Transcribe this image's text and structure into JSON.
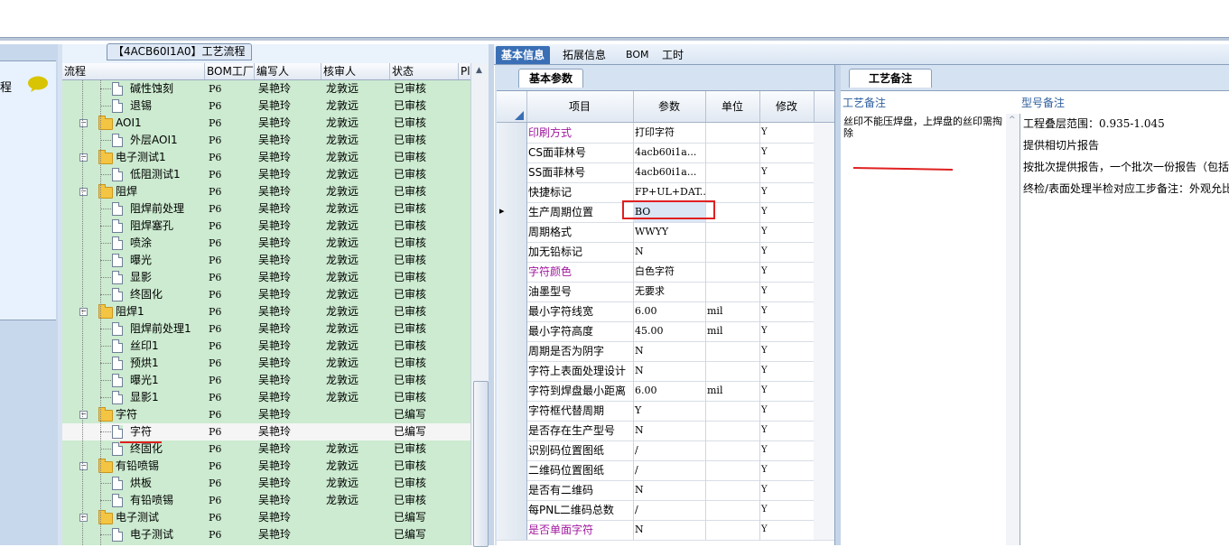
{
  "left_panel": {
    "label": "程"
  },
  "process_panel": {
    "title": "【4ACB60I1A0】工艺流程",
    "columns": [
      "流程",
      "BOM工厂",
      "编写人",
      "核审人",
      "状态",
      "Pl"
    ],
    "rows": [
      {
        "name": "碱性蚀刻",
        "type": "doc",
        "level": 2,
        "factory": "P6",
        "writer": "吴艳玲",
        "reviewer": "龙敦远",
        "status": "已审核"
      },
      {
        "name": "退锡",
        "type": "doc",
        "level": 2,
        "factory": "P6",
        "writer": "吴艳玲",
        "reviewer": "龙敦远",
        "status": "已审核"
      },
      {
        "name": "AOI1",
        "type": "folder",
        "level": 1,
        "factory": "P6",
        "writer": "吴艳玲",
        "reviewer": "龙敦远",
        "status": "已审核"
      },
      {
        "name": "外层AOI1",
        "type": "doc",
        "level": 2,
        "factory": "P6",
        "writer": "吴艳玲",
        "reviewer": "龙敦远",
        "status": "已审核"
      },
      {
        "name": "电子测试1",
        "type": "folder",
        "level": 1,
        "factory": "P6",
        "writer": "吴艳玲",
        "reviewer": "龙敦远",
        "status": "已审核"
      },
      {
        "name": "低阻测试1",
        "type": "doc",
        "level": 2,
        "factory": "P6",
        "writer": "吴艳玲",
        "reviewer": "龙敦远",
        "status": "已审核"
      },
      {
        "name": "阻焊",
        "type": "folder",
        "level": 1,
        "factory": "P6",
        "writer": "吴艳玲",
        "reviewer": "龙敦远",
        "status": "已审核"
      },
      {
        "name": "阻焊前处理",
        "type": "doc",
        "level": 2,
        "factory": "P6",
        "writer": "吴艳玲",
        "reviewer": "龙敦远",
        "status": "已审核"
      },
      {
        "name": "阻焊塞孔",
        "type": "doc",
        "level": 2,
        "factory": "P6",
        "writer": "吴艳玲",
        "reviewer": "龙敦远",
        "status": "已审核"
      },
      {
        "name": "喷涂",
        "type": "doc",
        "level": 2,
        "factory": "P6",
        "writer": "吴艳玲",
        "reviewer": "龙敦远",
        "status": "已审核"
      },
      {
        "name": "曝光",
        "type": "doc",
        "level": 2,
        "factory": "P6",
        "writer": "吴艳玲",
        "reviewer": "龙敦远",
        "status": "已审核"
      },
      {
        "name": "显影",
        "type": "doc",
        "level": 2,
        "factory": "P6",
        "writer": "吴艳玲",
        "reviewer": "龙敦远",
        "status": "已审核"
      },
      {
        "name": "终固化",
        "type": "doc",
        "level": 2,
        "factory": "P6",
        "writer": "吴艳玲",
        "reviewer": "龙敦远",
        "status": "已审核"
      },
      {
        "name": "阻焊1",
        "type": "folder",
        "level": 1,
        "factory": "P6",
        "writer": "吴艳玲",
        "reviewer": "龙敦远",
        "status": "已审核"
      },
      {
        "name": "阻焊前处理1",
        "type": "doc",
        "level": 2,
        "factory": "P6",
        "writer": "吴艳玲",
        "reviewer": "龙敦远",
        "status": "已审核"
      },
      {
        "name": "丝印1",
        "type": "doc",
        "level": 2,
        "factory": "P6",
        "writer": "吴艳玲",
        "reviewer": "龙敦远",
        "status": "已审核"
      },
      {
        "name": "预烘1",
        "type": "doc",
        "level": 2,
        "factory": "P6",
        "writer": "吴艳玲",
        "reviewer": "龙敦远",
        "status": "已审核"
      },
      {
        "name": "曝光1",
        "type": "doc",
        "level": 2,
        "factory": "P6",
        "writer": "吴艳玲",
        "reviewer": "龙敦远",
        "status": "已审核"
      },
      {
        "name": "显影1",
        "type": "doc",
        "level": 2,
        "factory": "P6",
        "writer": "吴艳玲",
        "reviewer": "龙敦远",
        "status": "已审核"
      },
      {
        "name": "字符",
        "type": "folder",
        "level": 1,
        "factory": "P6",
        "writer": "吴艳玲",
        "reviewer": "",
        "status": "已编写"
      },
      {
        "name": "字符",
        "type": "doc",
        "level": 2,
        "factory": "P6",
        "writer": "吴艳玲",
        "reviewer": "",
        "status": "已编写",
        "selected": true
      },
      {
        "name": "终固化",
        "type": "doc",
        "level": 2,
        "factory": "P6",
        "writer": "吴艳玲",
        "reviewer": "龙敦远",
        "status": "已审核"
      },
      {
        "name": "有铅喷锡",
        "type": "folder",
        "level": 1,
        "factory": "P6",
        "writer": "吴艳玲",
        "reviewer": "龙敦远",
        "status": "已审核"
      },
      {
        "name": "烘板",
        "type": "doc",
        "level": 2,
        "factory": "P6",
        "writer": "吴艳玲",
        "reviewer": "龙敦远",
        "status": "已审核"
      },
      {
        "name": "有铅喷锡",
        "type": "doc",
        "level": 2,
        "factory": "P6",
        "writer": "吴艳玲",
        "reviewer": "龙敦远",
        "status": "已审核"
      },
      {
        "name": "电子测试",
        "type": "folder",
        "level": 1,
        "factory": "P6",
        "writer": "吴艳玲",
        "reviewer": "",
        "status": "已编写"
      },
      {
        "name": "电子测试",
        "type": "doc",
        "level": 2,
        "factory": "P6",
        "writer": "吴艳玲",
        "reviewer": "",
        "status": "已编写"
      }
    ]
  },
  "tabs": [
    "基本信息",
    "拓展信息",
    "BOM",
    "工时"
  ],
  "basic_params": {
    "tab_label": "基本参数",
    "columns": [
      "项目",
      "参数",
      "单位",
      "修改"
    ],
    "rows": [
      {
        "item": "印刷方式",
        "value": "打印字符",
        "unit": "",
        "mod": "Y",
        "color": "#a0189e"
      },
      {
        "item": "CS面菲林号",
        "value": "4acb60i1a...",
        "unit": "",
        "mod": "Y"
      },
      {
        "item": "SS面菲林号",
        "value": "4acb60i1a...",
        "unit": "",
        "mod": "Y"
      },
      {
        "item": "快捷标记",
        "value": "FP+UL+DAT...",
        "unit": "",
        "mod": "Y"
      },
      {
        "item": "生产周期位置",
        "value": "BO",
        "unit": "",
        "mod": "Y",
        "current": true
      },
      {
        "item": "周期格式",
        "value": "WWYY",
        "unit": "",
        "mod": "Y"
      },
      {
        "item": "加无铅标记",
        "value": "N",
        "unit": "",
        "mod": "Y"
      },
      {
        "item": "字符颜色",
        "value": "白色字符",
        "unit": "",
        "mod": "Y",
        "color": "#a0189e"
      },
      {
        "item": "油墨型号",
        "value": "无要求",
        "unit": "",
        "mod": "Y"
      },
      {
        "item": "最小字符线宽",
        "value": "6.00",
        "unit": "mil",
        "mod": "Y"
      },
      {
        "item": "最小字符高度",
        "value": "45.00",
        "unit": "mil",
        "mod": "Y"
      },
      {
        "item": "周期是否为阴字",
        "value": "N",
        "unit": "",
        "mod": "Y"
      },
      {
        "item": "字符上表面处理设计",
        "value": "N",
        "unit": "",
        "mod": "Y"
      },
      {
        "item": "字符到焊盘最小距离",
        "value": "6.00",
        "unit": "mil",
        "mod": "Y"
      },
      {
        "item": "字符框代替周期",
        "value": "Y",
        "unit": "",
        "mod": "Y"
      },
      {
        "item": "是否存在生产型号",
        "value": "N",
        "unit": "",
        "mod": "Y"
      },
      {
        "item": "识别码位置图纸",
        "value": "/",
        "unit": "",
        "mod": "Y"
      },
      {
        "item": "二维码位置图纸",
        "value": "/",
        "unit": "",
        "mod": "Y"
      },
      {
        "item": "是否有二维码",
        "value": "N",
        "unit": "",
        "mod": "Y"
      },
      {
        "item": "每PNL二维码总数",
        "value": "/",
        "unit": "",
        "mod": "Y"
      },
      {
        "item": "是否单面字符",
        "value": "N",
        "unit": "",
        "mod": "Y",
        "color": "#a0189e"
      }
    ]
  },
  "process_notes": {
    "tab_label": "工艺备注",
    "col1_header": "工艺备注",
    "col2_header": "型号备注",
    "col1_text": "丝印不能压焊盘，上焊盘的丝印需掏除",
    "col2_lines": [
      "工程叠层范围：0.935-1.045",
      "提供相切片报告",
      "按批次提供报告，一个批次一份报告（包括",
      "终检/表面处理半检对应工步备注：外观允比"
    ]
  }
}
